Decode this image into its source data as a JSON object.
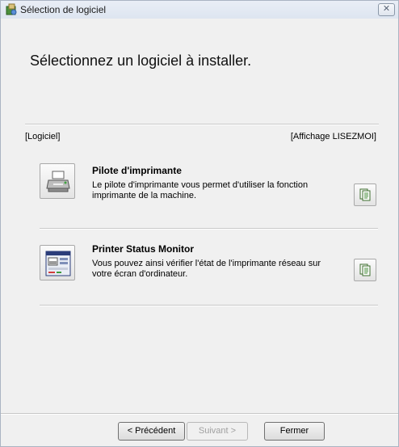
{
  "window": {
    "title": "Sélection de logiciel",
    "close_glyph": "✕"
  },
  "heading": "Sélectionnez un logiciel à installer.",
  "columns": {
    "left": "[Logiciel]",
    "right": "[Affichage LISEZMOI]"
  },
  "items": [
    {
      "title": "Pilote d'imprimante",
      "description": "Le pilote d'imprimante vous permet d'utiliser la fonction imprimante de la machine.",
      "icon": "printer-icon"
    },
    {
      "title": "Printer Status Monitor",
      "description": "Vous pouvez ainsi vérifier l'état de l'imprimante réseau sur votre écran d'ordinateur.",
      "icon": "status-monitor-icon"
    }
  ],
  "buttons": {
    "back": "< Précédent",
    "next": "Suivant >",
    "close": "Fermer"
  }
}
